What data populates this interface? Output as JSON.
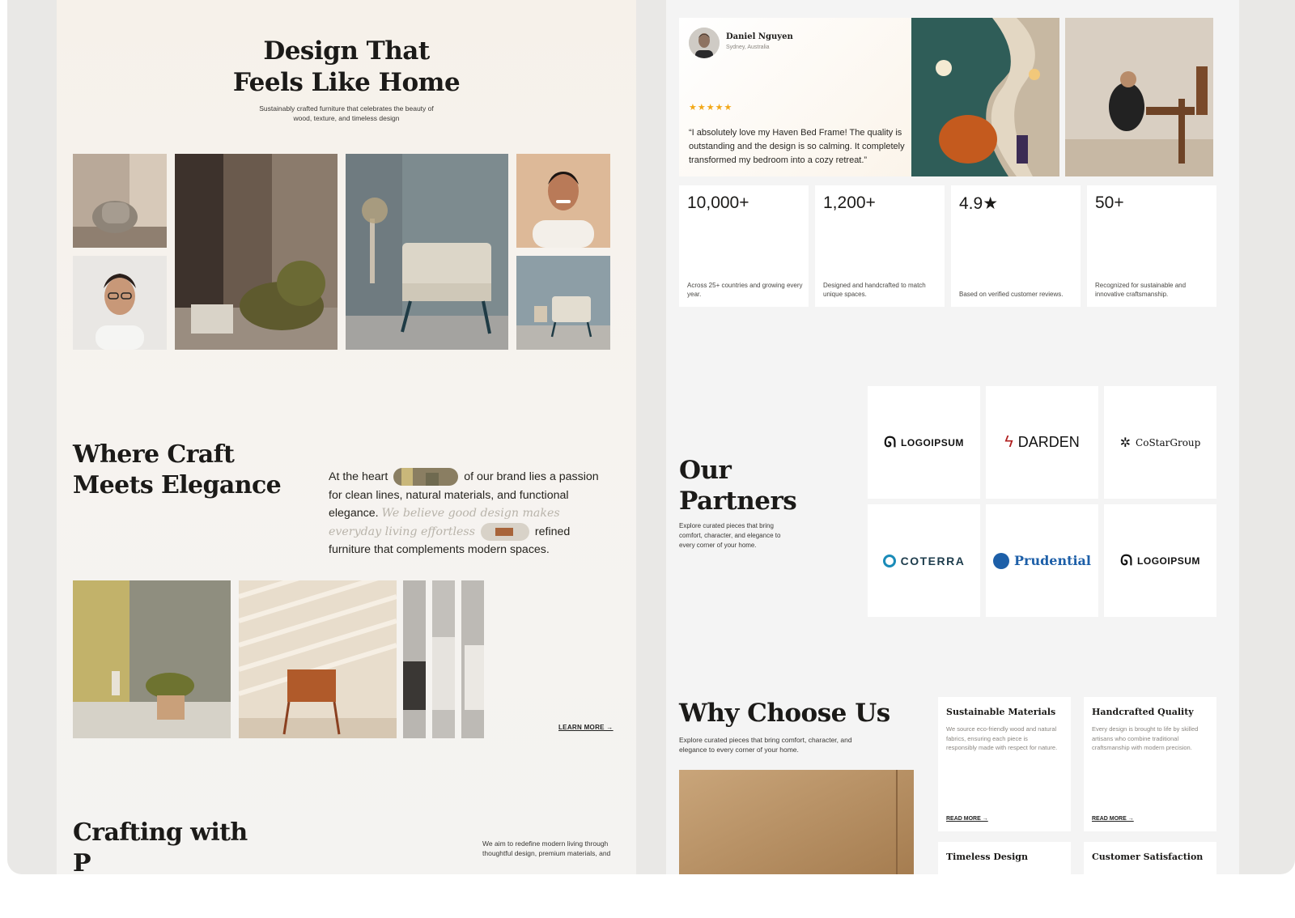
{
  "left": {
    "hero": {
      "title_line1": "Design That",
      "title_line2": "Feels Like Home",
      "subtitle": "Sustainably crafted furniture that celebrates the beauty of wood, texture, and timeless design"
    },
    "craft": {
      "title_line1": "Where Craft",
      "title_line2": "Meets Elegance",
      "text_part1": "At the heart",
      "text_part2": "of our brand lies a passion for clean lines, natural materials, and functional elegance.",
      "text_italic": "We believe good design makes everyday living effortless",
      "text_part3": "refined furniture that complements modern spaces.",
      "learn_more": "LEARN MORE →"
    },
    "crafting": {
      "title_line1": "Crafting with",
      "title_line2": "P",
      "text": "We aim to redefine modern living through thoughtful design, premium materials, and"
    }
  },
  "right": {
    "review": {
      "name": "Daniel Nguyen",
      "location": "Sydney, Australia",
      "stars": "★★★★★",
      "text": "“I absolutely love my Haven Bed Frame! The quality is outstanding and the design is so calming. It completely transformed my bedroom into a cozy retreat.”"
    },
    "stats": [
      {
        "value": "10,000+",
        "desc": "Across 25+ countries and growing every year."
      },
      {
        "value": "1,200+",
        "desc": "Designed and handcrafted to match unique spaces."
      },
      {
        "value": "4.9★",
        "desc": "Based on verified customer reviews."
      },
      {
        "value": "50+",
        "desc": "Recognized for sustainable and innovative craftsmanship."
      }
    ],
    "partners": {
      "title_line1": "Our",
      "title_line2": "Partners",
      "desc": "Explore curated pieces that bring comfort, character, and elegance to every corner of your home.",
      "logos": [
        "LOGOIPSUM",
        "DARDEN",
        "CoStarGroup",
        "COTERRA",
        "Prudential",
        "LOGOIPSUM"
      ]
    },
    "why": {
      "title": "Why Choose Us",
      "desc": "Explore curated pieces that bring comfort, character, and elegance to every corner of your home.",
      "cards": [
        {
          "title": "Sustainable Materials",
          "desc": "We source eco-friendly wood and natural fabrics, ensuring each piece is responsibly made with respect for nature.",
          "more": "READ MORE →"
        },
        {
          "title": "Handcrafted Quality",
          "desc": "Every design is brought to life by skilled artisans who combine traditional craftsmanship with modern precision.",
          "more": "READ MORE →"
        }
      ],
      "cards_partial": [
        "Timeless Design",
        "Customer Satisfaction"
      ]
    }
  }
}
